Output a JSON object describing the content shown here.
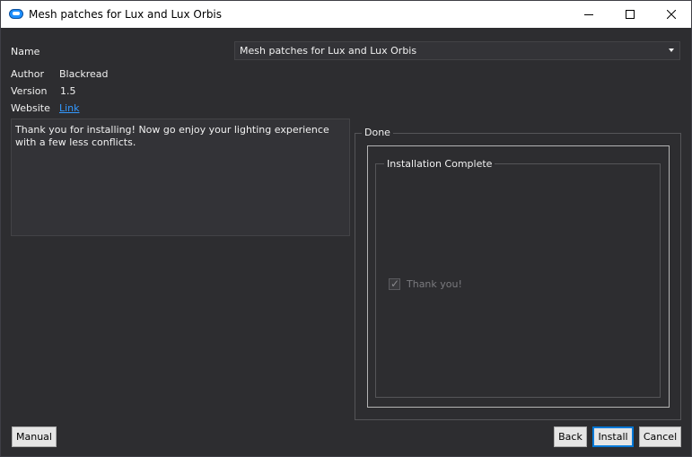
{
  "window": {
    "title": "Mesh patches for Lux and Lux Orbis"
  },
  "fields": {
    "name_label": "Name",
    "author_label": "Author",
    "author_value": "Blackread",
    "version_label": "Version",
    "version_value": "1.5",
    "website_label": "Website",
    "website_value": "Link"
  },
  "name_select": {
    "selected": "Mesh patches for Lux and Lux Orbis"
  },
  "description": "Thank you for installing! Now go enjoy your lighting experience with a few less conflicts.",
  "done_group": {
    "legend": "Done",
    "inner_group_legend": "Installation Complete",
    "checkbox_label": "Thank you!",
    "checkbox_checked": true
  },
  "buttons": {
    "manual": "Manual",
    "back": "Back",
    "install": "Install",
    "cancel": "Cancel"
  },
  "colors": {
    "background": "#2d2d30",
    "link": "#3399ff",
    "accent_border": "#0078d7"
  }
}
